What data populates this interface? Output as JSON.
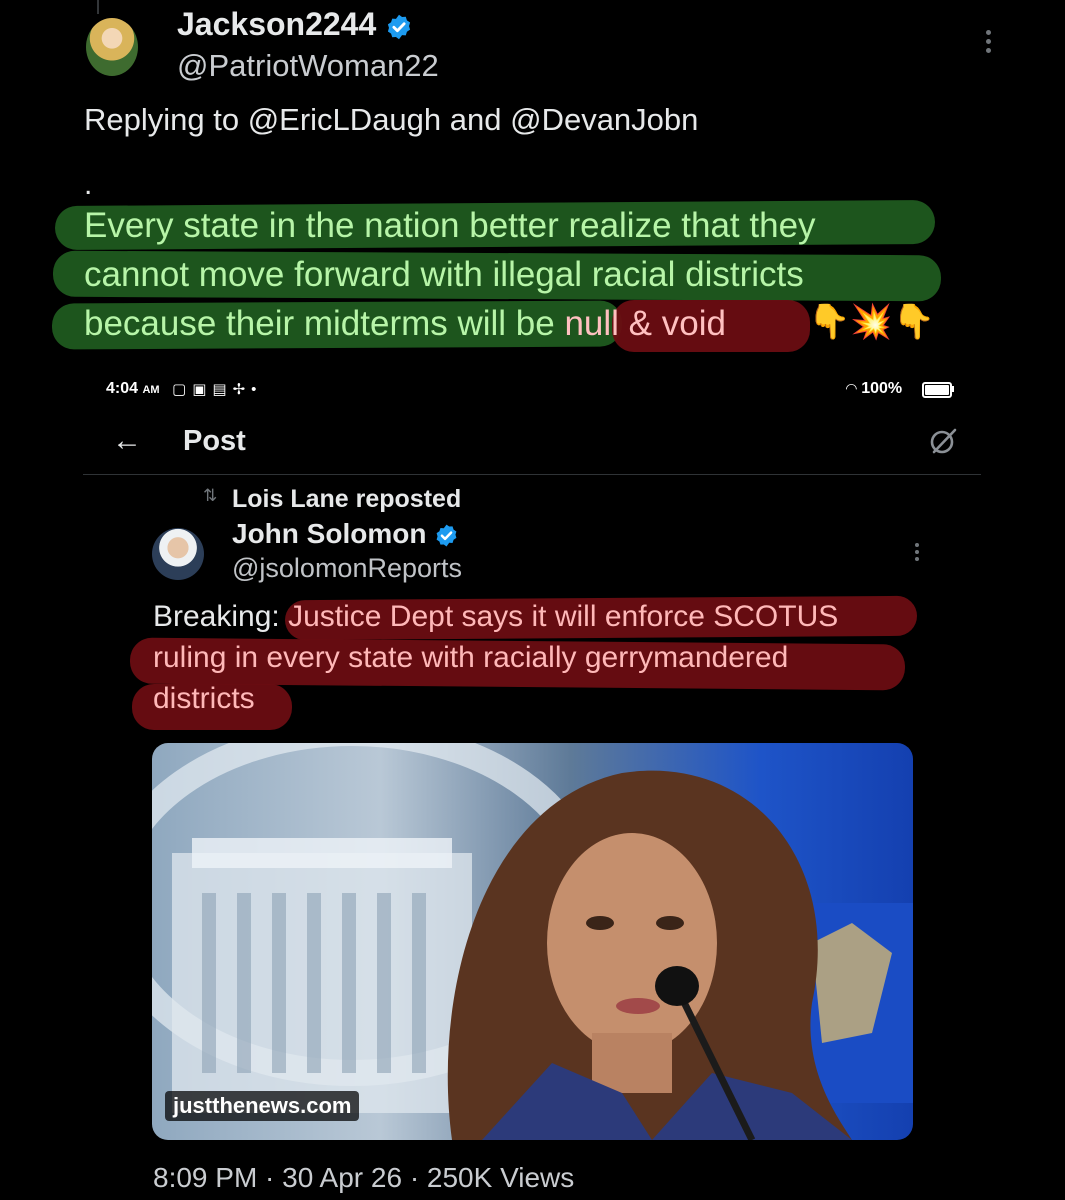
{
  "outer_tweet": {
    "author_name": "Jackson2244",
    "author_handle": "@PatriotWoman22",
    "replying_to": "Replying to @EricLDaugh and @DevanJobn",
    "dot_line": ".",
    "text_line1": "Every state in the nation better realize that they",
    "text_line2": "cannot move forward with illegal racial districts",
    "text_line3_a": "because their midterms will be ",
    "text_line3_b": "null & void",
    "emojis": "👇💥👇"
  },
  "embedded_screenshot": {
    "status_bar": {
      "time": "4:04",
      "ampm": "AM",
      "battery": "100%"
    },
    "header": {
      "title": "Post"
    },
    "repost_label": "Lois Lane reposted",
    "inner_tweet": {
      "author_name": "John Solomon",
      "author_handle": "@jsolomonReports",
      "text_prefix": "Breaking:",
      "text_line1_rest": " Justice Dept says it will enforce SCOTUS",
      "text_line2": "ruling in every state with racially gerrymandered",
      "text_line3": "districts",
      "image_source": "justthenews.com",
      "timestamp": "8:09 PM · 30 Apr 26 · 250K Views"
    }
  },
  "colors": {
    "background": "#000000",
    "verified_blue": "#1d9bf0",
    "green_highlight": "#1f5c1f",
    "red_highlight": "#6a0d12"
  }
}
